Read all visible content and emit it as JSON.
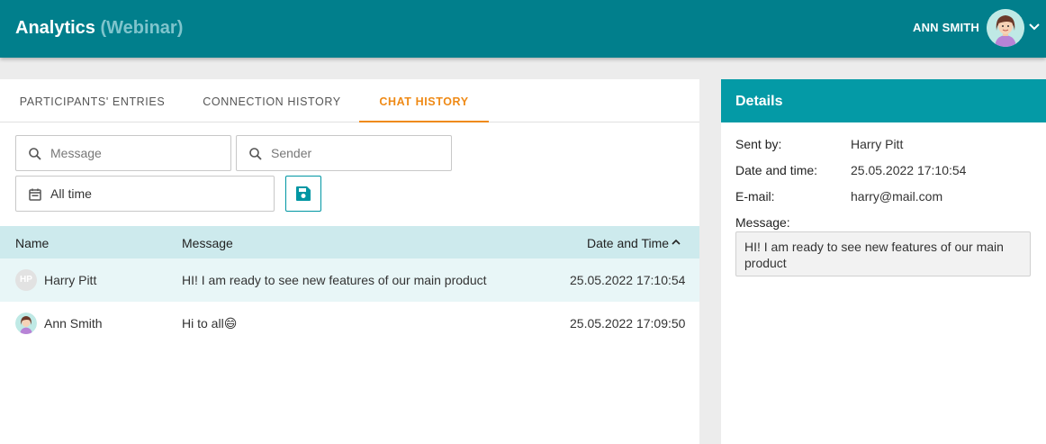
{
  "header": {
    "title": "Analytics",
    "subtitle": "(Webinar)",
    "user_name": "ANN SMITH",
    "bg_color": "#017f8c"
  },
  "tabs": [
    {
      "label": "PARTICIPANTS' ENTRIES",
      "active": false
    },
    {
      "label": "CONNECTION HISTORY",
      "active": false
    },
    {
      "label": "CHAT HISTORY",
      "active": true
    }
  ],
  "filters": {
    "message_placeholder": "Message",
    "sender_placeholder": "Sender",
    "date_range": "All time"
  },
  "table": {
    "columns": [
      "Name",
      "Message",
      "Date and Time"
    ],
    "sort_column": "Date and Time",
    "sort_direction": "ascending",
    "rows": [
      {
        "initials": "HP",
        "name": "Harry Pitt",
        "message": "HI! I am ready to see new features of our main product",
        "datetime": "25.05.2022 17:10:54",
        "selected": true
      },
      {
        "initials": "",
        "name": "Ann Smith",
        "message": "Hi to all",
        "emoji": "😄",
        "datetime": "25.05.2022 17:09:50",
        "selected": false
      }
    ]
  },
  "details": {
    "title": "Details",
    "sent_by_label": "Sent by:",
    "sent_by": "Harry Pitt",
    "datetime_label": "Date and time:",
    "datetime": "25.05.2022 17:10:54",
    "email_label": "E-mail:",
    "email": "harry@mail.com",
    "message_label": "Message:",
    "message": "HI! I am ready to see new features of our main product"
  },
  "colors": {
    "accent": "#ef8a16",
    "teal": "#049aa6",
    "header_row": "#cdeaed",
    "selected_row": "#e8f6f7"
  }
}
